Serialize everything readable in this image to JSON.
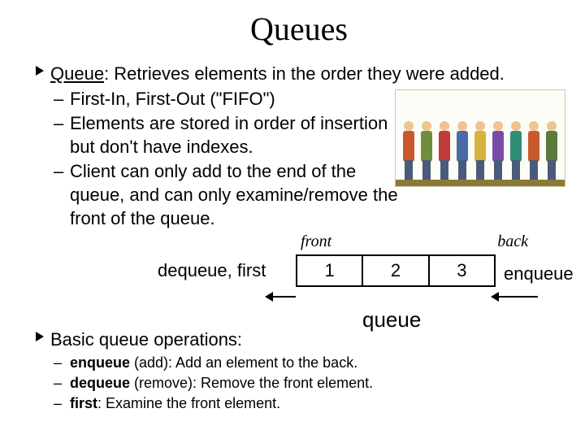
{
  "title": "Queues",
  "bullet1": {
    "term": "Queue",
    "rest": ": Retrieves elements in the order they were added.",
    "subs": [
      "First-In, First-Out (\"FIFO\")",
      "Elements are stored in order of insertion but don't have indexes.",
      "Client can only add to the end of the queue, and can only examine/remove the front of the queue."
    ]
  },
  "diagram": {
    "front": "front",
    "back": "back",
    "cells": [
      "1",
      "2",
      "3"
    ],
    "dequeue": "dequeue, first",
    "enqueue": "enqueue",
    "caption": "queue"
  },
  "bullet2": {
    "lead": "Basic queue operations:",
    "ops": [
      {
        "name": "enqueue",
        "paren": " (add): ",
        "desc": "Add an element to the back."
      },
      {
        "name": "dequeue",
        "paren": " (remove): ",
        "desc": "Remove the front element."
      },
      {
        "name": "first",
        "paren": ": ",
        "desc": "Examine the front element."
      }
    ]
  }
}
